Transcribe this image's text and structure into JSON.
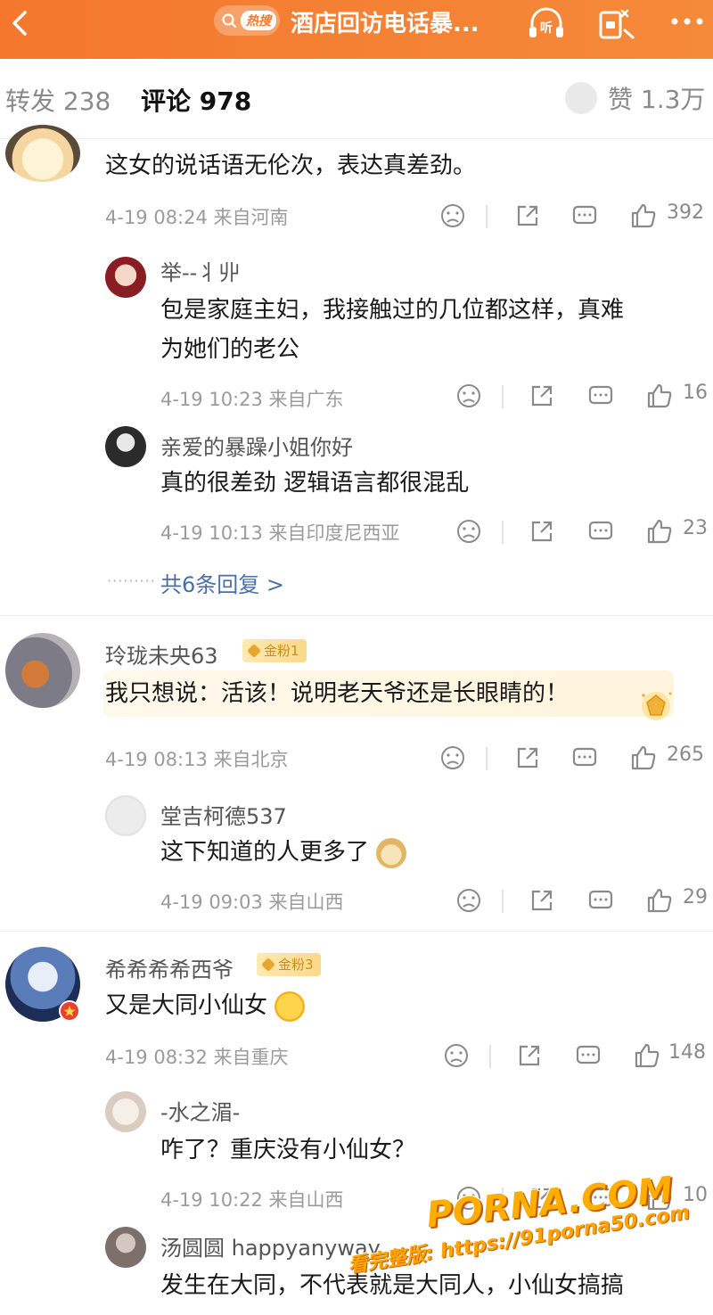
{
  "topbar": {
    "hot_label": "热搜",
    "title": "酒店回访电话暴...",
    "accent": "#f47a30"
  },
  "tabs": {
    "repost": "转发 238",
    "comment": "评论 978",
    "like": "赞 1.3万"
  },
  "comments": [
    {
      "name": "",
      "text": "这女的说话语无伦次，表达真差劲。",
      "time": "4-19 08:24 来自河南",
      "likes": "392",
      "replies": [
        {
          "name": "举--丬丱",
          "text_lines": [
            "包是家庭主妇，我接触过的几位都这样，真难",
            "为她们的老公"
          ],
          "time": "4-19 10:23 来自广东",
          "likes": "16"
        },
        {
          "name": "亲爱的暴躁小姐你好",
          "text_lines": [
            "真的很差劲 逻辑语言都很混乱"
          ],
          "time": "4-19 10:13 来自印度尼西亚",
          "likes": "23"
        }
      ],
      "more_replies": "共6条回复 >"
    },
    {
      "name": "玲珑未央63",
      "badge": "金粉1",
      "text": "我只想说：活该！说明老天爷还是长眼睛的！",
      "time": "4-19 08:13 来自北京",
      "likes": "265",
      "replies": [
        {
          "name": "堂吉柯德537",
          "text_lines": [
            "这下知道的人更多了"
          ],
          "time": "4-19 09:03 来自山西",
          "likes": "29"
        }
      ]
    },
    {
      "name": "希希希希西爷",
      "badge": "金粉3",
      "text": "又是大同小仙女",
      "time": "4-19 08:32 来自重庆",
      "likes": "148",
      "replies": [
        {
          "name": "-水之湄-",
          "text_lines": [
            "咋了？重庆没有小仙女？"
          ],
          "time": "4-19 10:22 来自山西",
          "likes": "10"
        },
        {
          "name": "汤圆圆 happyanyway",
          "text_lines": [
            "发生在大同，不代表就是大同人，小仙女搞搞"
          ],
          "time": "",
          "likes": ""
        }
      ]
    }
  ],
  "watermark": {
    "line1": "PORNA.COM",
    "line2": "看完整版: https://91porna50.com"
  }
}
